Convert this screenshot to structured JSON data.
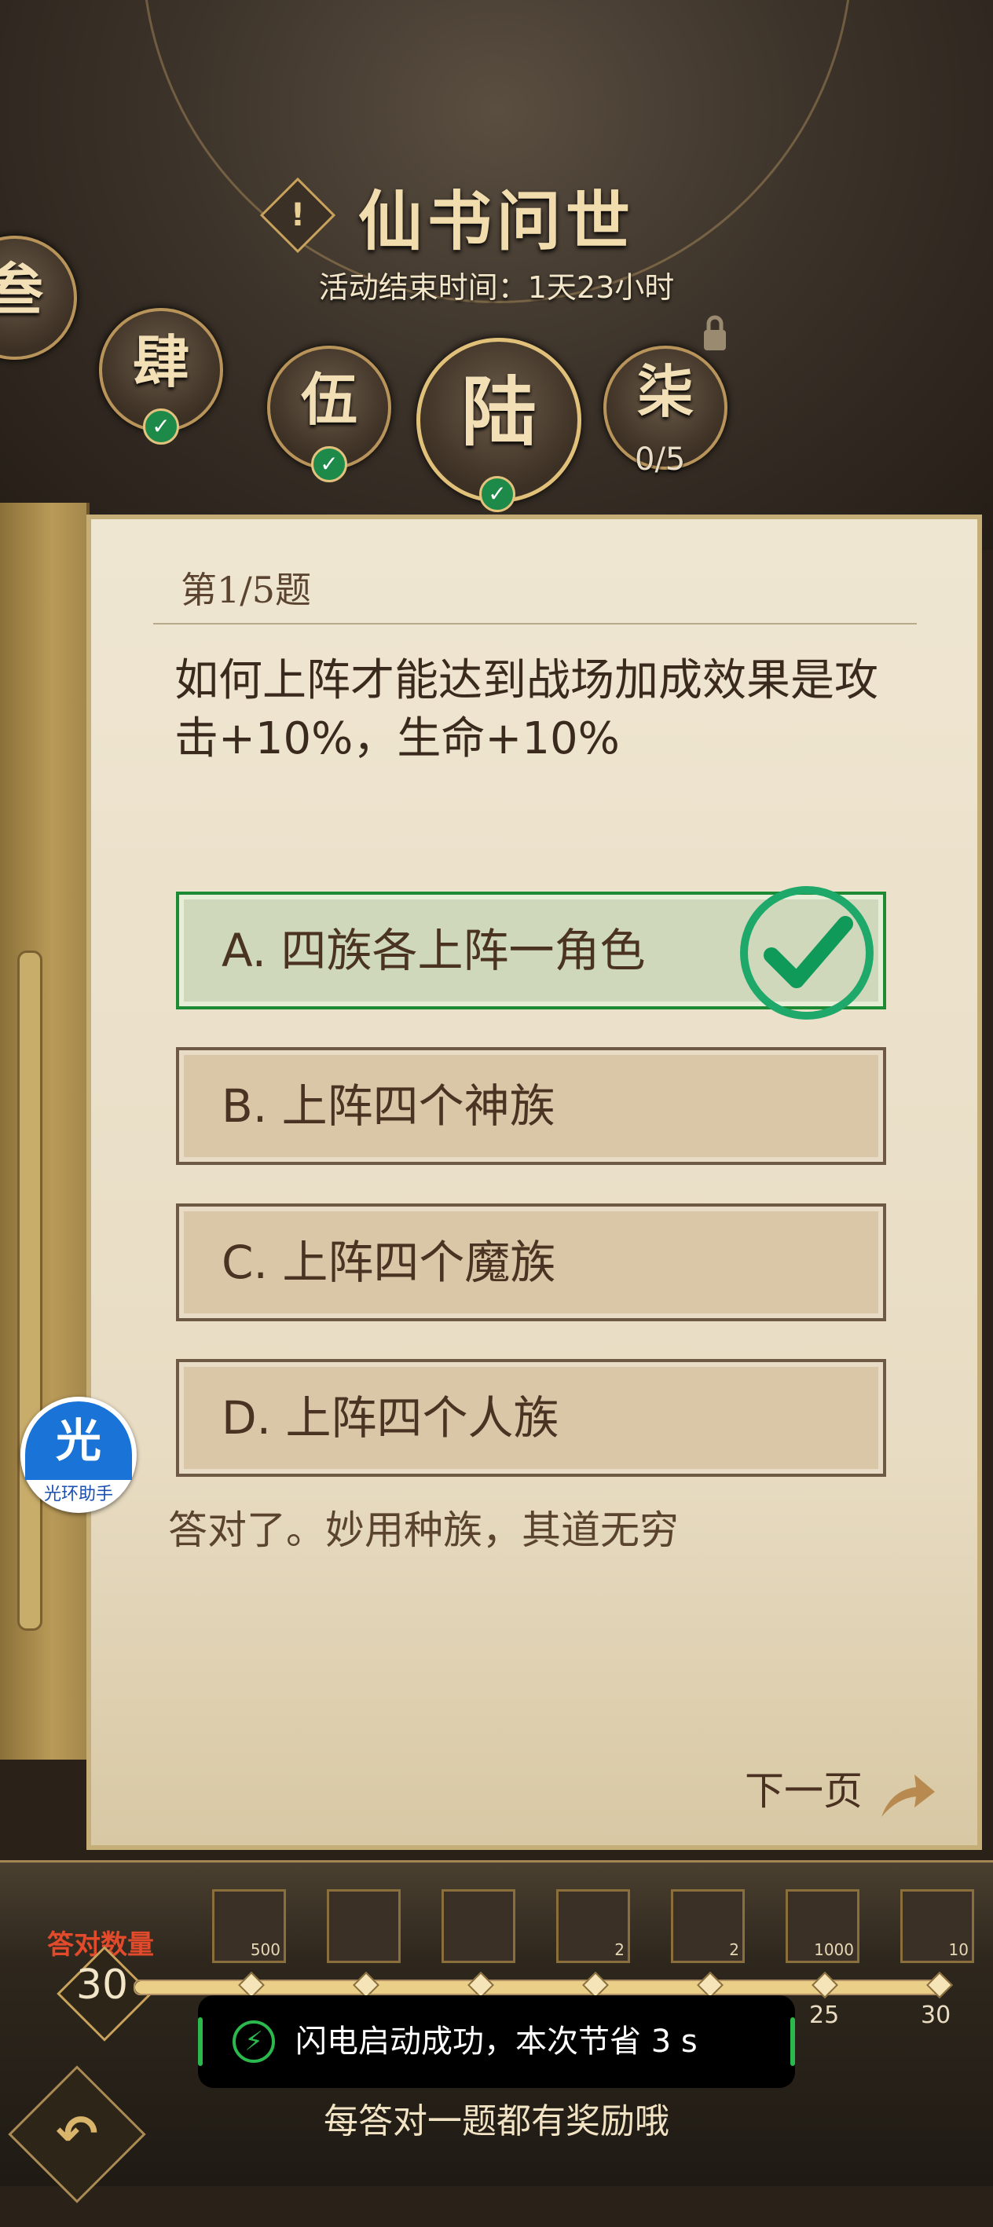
{
  "header": {
    "title": "仙书问世",
    "alert_icon": "exclamation-icon",
    "subtitle": "活动结束时间：1天23小时"
  },
  "chapters": [
    {
      "label": "叁",
      "status": "done"
    },
    {
      "label": "肆",
      "status": "done"
    },
    {
      "label": "伍",
      "status": "done"
    },
    {
      "label": "陆",
      "status": "active-done"
    },
    {
      "label": "柒",
      "status": "locked",
      "progress": "0/5"
    }
  ],
  "quiz": {
    "question_number": "第1/5题",
    "question": "如何上阵才能达到战场加成效果是攻击+10%，生命+10%",
    "options": [
      {
        "label": "A. 四族各上阵一角色",
        "state": "correct"
      },
      {
        "label": "B. 上阵四个神族",
        "state": "normal"
      },
      {
        "label": "C. 上阵四个魔族",
        "state": "normal"
      },
      {
        "label": "D. 上阵四个人族",
        "state": "normal"
      }
    ],
    "feedback": "答对了。妙用种族，其道无穷",
    "next_label": "下一页"
  },
  "helper": {
    "glyph": "光",
    "label": "光环助手"
  },
  "rewards": {
    "count_label": "答对数量",
    "count_value": "30",
    "items": [
      {
        "icon": "scroll-icon",
        "qty": "500"
      },
      {
        "icon": "chest-icon",
        "qty": ""
      },
      {
        "icon": "chest-icon",
        "qty": ""
      },
      {
        "icon": "chest-icon",
        "qty": "2"
      },
      {
        "icon": "chest-icon",
        "qty": "2"
      },
      {
        "icon": "scroll-icon",
        "qty": "1000"
      },
      {
        "icon": "dragon-icon",
        "qty": "10"
      }
    ],
    "ticks": [
      "25",
      "30"
    ],
    "progress_fraction": 1.0
  },
  "toast": {
    "text": "闪电启动成功，本次节省 3 s"
  },
  "footer": {
    "hint": "每答对一题都有奖励哦"
  },
  "colors": {
    "accent_gold": "#c9a25c",
    "correct_green": "#1d8a34",
    "panel": "#efe6d2"
  }
}
